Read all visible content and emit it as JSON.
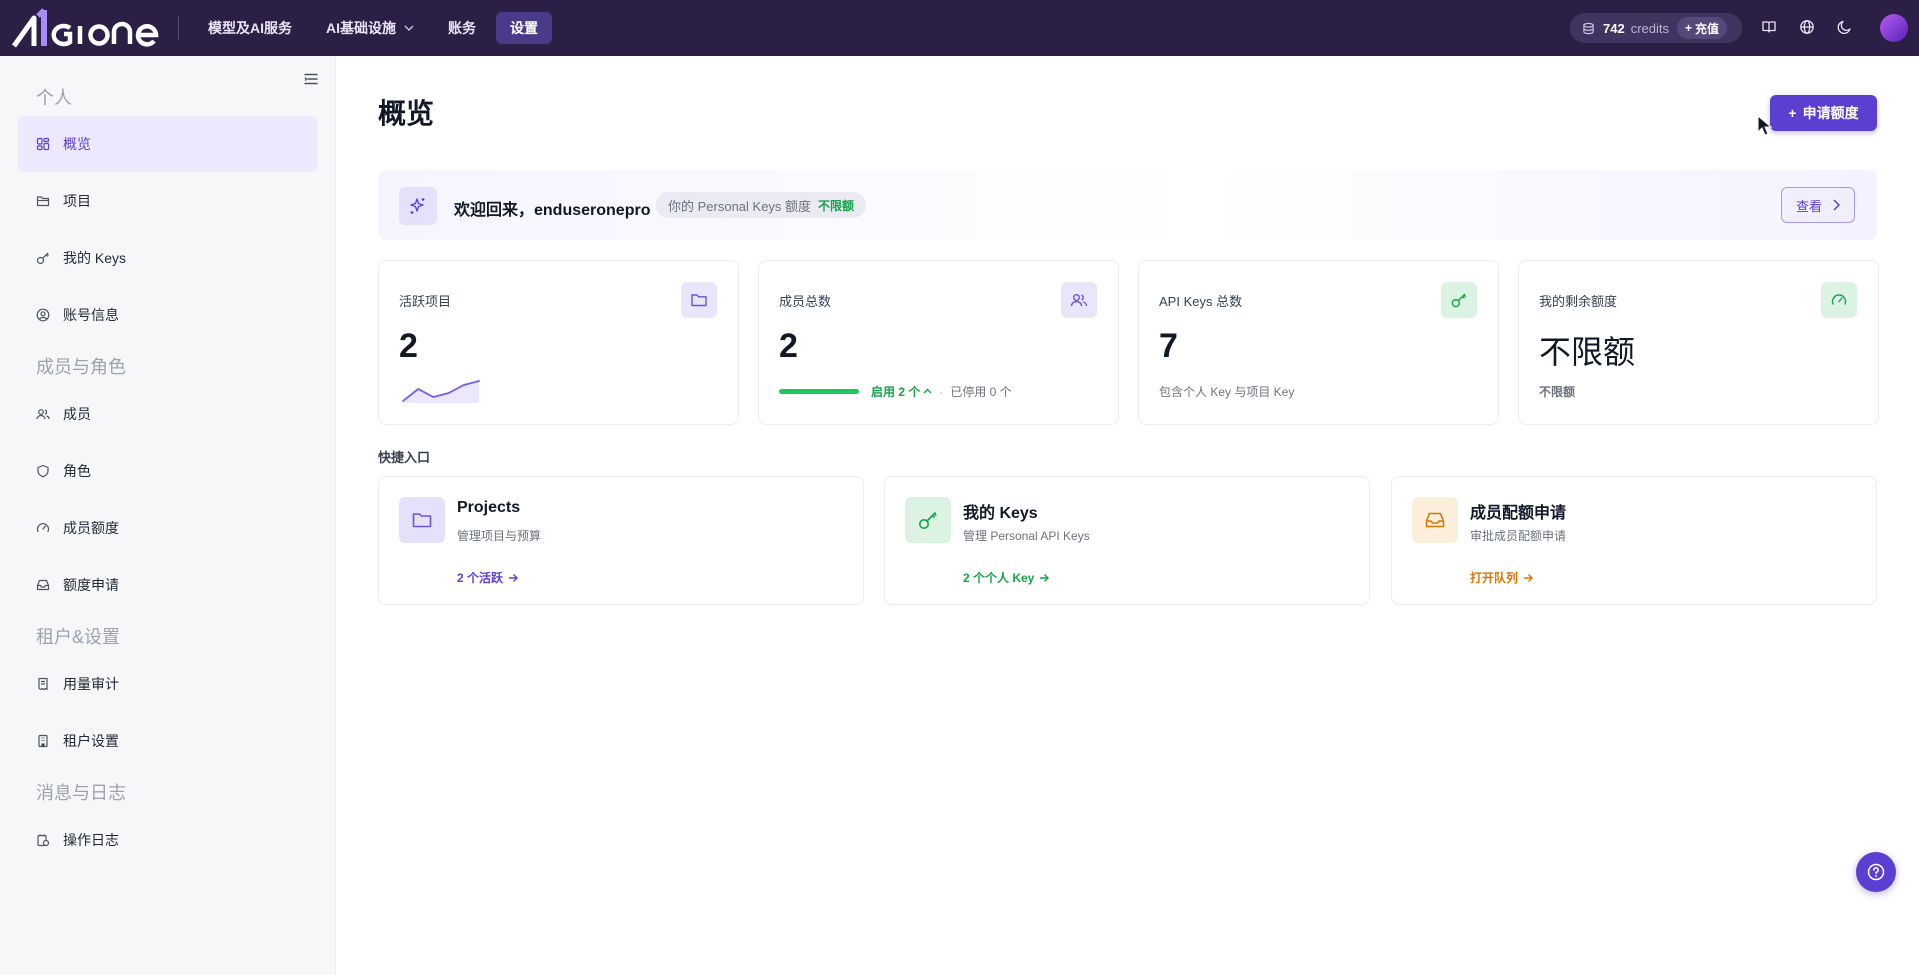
{
  "header": {
    "nav": [
      {
        "label": "模型及AI服务",
        "active": false,
        "dropdown": false
      },
      {
        "label": "AI基础设施",
        "active": false,
        "dropdown": true
      },
      {
        "label": "账务",
        "active": false,
        "dropdown": false
      },
      {
        "label": "设置",
        "active": true,
        "dropdown": false
      }
    ],
    "credits": {
      "value": "742",
      "unit": "credits",
      "recharge_label": "充值"
    },
    "icons": [
      "database-icon",
      "book-icon",
      "globe-icon",
      "moon-icon"
    ]
  },
  "sidebar": {
    "sections": [
      {
        "title": "个人",
        "items": [
          {
            "label": "概览",
            "icon": "dashboard-icon",
            "active": true
          },
          {
            "label": "项目",
            "icon": "folder-icon",
            "active": false
          },
          {
            "label": "我的 Keys",
            "icon": "key-icon",
            "active": false
          },
          {
            "label": "账号信息",
            "icon": "user-circle-icon",
            "active": false
          }
        ]
      },
      {
        "title": "成员与角色",
        "items": [
          {
            "label": "成员",
            "icon": "users-icon",
            "active": false
          },
          {
            "label": "角色",
            "icon": "shield-icon",
            "active": false
          },
          {
            "label": "成员额度",
            "icon": "gauge-icon",
            "active": false
          },
          {
            "label": "额度申请",
            "icon": "inbox-icon",
            "active": false
          }
        ]
      },
      {
        "title": "租户&设置",
        "items": [
          {
            "label": "用量审计",
            "icon": "receipt-icon",
            "active": false
          },
          {
            "label": "租户设置",
            "icon": "building-icon",
            "active": false
          }
        ]
      },
      {
        "title": "消息与日志",
        "items": [
          {
            "label": "操作日志",
            "icon": "log-icon",
            "active": false
          }
        ]
      }
    ]
  },
  "main": {
    "title": "概览",
    "apply_button": "申请额度",
    "welcome": {
      "text": "欢迎回来，enduseronepro",
      "pill_label": "你的 Personal Keys 额度",
      "pill_value": "不限额",
      "view_button": "查看"
    },
    "stats": [
      {
        "label": "活跃项目",
        "value": "2",
        "icon": "folder-icon"
      },
      {
        "label": "成员总数",
        "value": "2",
        "icon": "users-icon",
        "enabled": "启用 2 个",
        "disabled": "已停用 0 个",
        "enabled_ratio": 1.0
      },
      {
        "label": "API Keys 总数",
        "value": "7",
        "icon": "key-icon",
        "sub": "包含个人 Key 与项目 Key"
      },
      {
        "label": "我的剩余额度",
        "value": "不限额",
        "icon": "gauge-icon",
        "sub": "不限额"
      }
    ],
    "sparkline": [
      3,
      6,
      4,
      5,
      7,
      8
    ],
    "quick_title": "快捷入口",
    "quick": [
      {
        "title": "Projects",
        "sub": "管理项目与预算",
        "link": "2 个活跃",
        "icon": "folder-icon",
        "color": "#5b3fd1"
      },
      {
        "title": "我的 Keys",
        "sub": "管理 Personal API Keys",
        "link": "2 个个人 Key",
        "icon": "key-icon",
        "color": "#16a34a"
      },
      {
        "title": "成员配额申请",
        "sub": "审批成员配额申请",
        "link": "打开队列",
        "icon": "inbox-icon",
        "color": "#d97706"
      }
    ]
  },
  "colors": {
    "brand": "#5b3fd1",
    "topbar": "#2b1f45",
    "success": "#16a34a",
    "warning": "#d97706"
  }
}
